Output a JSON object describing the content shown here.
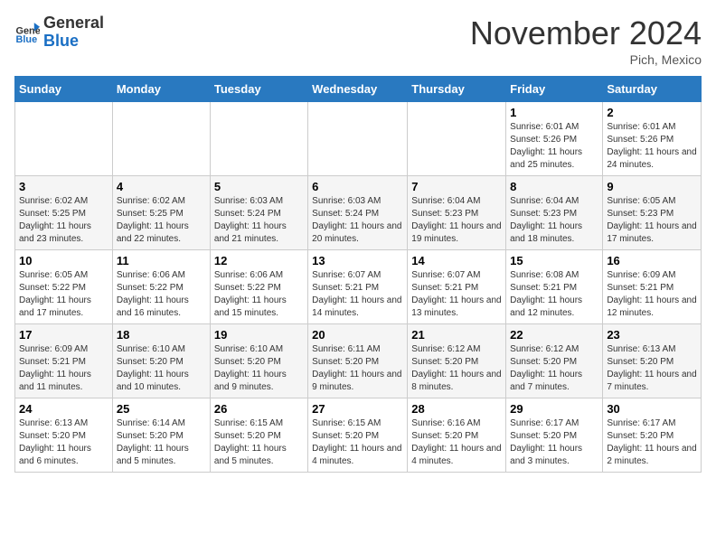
{
  "header": {
    "logo_line1": "General",
    "logo_line2": "Blue",
    "month_title": "November 2024",
    "location": "Pich, Mexico"
  },
  "weekdays": [
    "Sunday",
    "Monday",
    "Tuesday",
    "Wednesday",
    "Thursday",
    "Friday",
    "Saturday"
  ],
  "weeks": [
    [
      {
        "day": "",
        "info": ""
      },
      {
        "day": "",
        "info": ""
      },
      {
        "day": "",
        "info": ""
      },
      {
        "day": "",
        "info": ""
      },
      {
        "day": "",
        "info": ""
      },
      {
        "day": "1",
        "info": "Sunrise: 6:01 AM\nSunset: 5:26 PM\nDaylight: 11 hours and 25 minutes."
      },
      {
        "day": "2",
        "info": "Sunrise: 6:01 AM\nSunset: 5:26 PM\nDaylight: 11 hours and 24 minutes."
      }
    ],
    [
      {
        "day": "3",
        "info": "Sunrise: 6:02 AM\nSunset: 5:25 PM\nDaylight: 11 hours and 23 minutes."
      },
      {
        "day": "4",
        "info": "Sunrise: 6:02 AM\nSunset: 5:25 PM\nDaylight: 11 hours and 22 minutes."
      },
      {
        "day": "5",
        "info": "Sunrise: 6:03 AM\nSunset: 5:24 PM\nDaylight: 11 hours and 21 minutes."
      },
      {
        "day": "6",
        "info": "Sunrise: 6:03 AM\nSunset: 5:24 PM\nDaylight: 11 hours and 20 minutes."
      },
      {
        "day": "7",
        "info": "Sunrise: 6:04 AM\nSunset: 5:23 PM\nDaylight: 11 hours and 19 minutes."
      },
      {
        "day": "8",
        "info": "Sunrise: 6:04 AM\nSunset: 5:23 PM\nDaylight: 11 hours and 18 minutes."
      },
      {
        "day": "9",
        "info": "Sunrise: 6:05 AM\nSunset: 5:23 PM\nDaylight: 11 hours and 17 minutes."
      }
    ],
    [
      {
        "day": "10",
        "info": "Sunrise: 6:05 AM\nSunset: 5:22 PM\nDaylight: 11 hours and 17 minutes."
      },
      {
        "day": "11",
        "info": "Sunrise: 6:06 AM\nSunset: 5:22 PM\nDaylight: 11 hours and 16 minutes."
      },
      {
        "day": "12",
        "info": "Sunrise: 6:06 AM\nSunset: 5:22 PM\nDaylight: 11 hours and 15 minutes."
      },
      {
        "day": "13",
        "info": "Sunrise: 6:07 AM\nSunset: 5:21 PM\nDaylight: 11 hours and 14 minutes."
      },
      {
        "day": "14",
        "info": "Sunrise: 6:07 AM\nSunset: 5:21 PM\nDaylight: 11 hours and 13 minutes."
      },
      {
        "day": "15",
        "info": "Sunrise: 6:08 AM\nSunset: 5:21 PM\nDaylight: 11 hours and 12 minutes."
      },
      {
        "day": "16",
        "info": "Sunrise: 6:09 AM\nSunset: 5:21 PM\nDaylight: 11 hours and 12 minutes."
      }
    ],
    [
      {
        "day": "17",
        "info": "Sunrise: 6:09 AM\nSunset: 5:21 PM\nDaylight: 11 hours and 11 minutes."
      },
      {
        "day": "18",
        "info": "Sunrise: 6:10 AM\nSunset: 5:20 PM\nDaylight: 11 hours and 10 minutes."
      },
      {
        "day": "19",
        "info": "Sunrise: 6:10 AM\nSunset: 5:20 PM\nDaylight: 11 hours and 9 minutes."
      },
      {
        "day": "20",
        "info": "Sunrise: 6:11 AM\nSunset: 5:20 PM\nDaylight: 11 hours and 9 minutes."
      },
      {
        "day": "21",
        "info": "Sunrise: 6:12 AM\nSunset: 5:20 PM\nDaylight: 11 hours and 8 minutes."
      },
      {
        "day": "22",
        "info": "Sunrise: 6:12 AM\nSunset: 5:20 PM\nDaylight: 11 hours and 7 minutes."
      },
      {
        "day": "23",
        "info": "Sunrise: 6:13 AM\nSunset: 5:20 PM\nDaylight: 11 hours and 7 minutes."
      }
    ],
    [
      {
        "day": "24",
        "info": "Sunrise: 6:13 AM\nSunset: 5:20 PM\nDaylight: 11 hours and 6 minutes."
      },
      {
        "day": "25",
        "info": "Sunrise: 6:14 AM\nSunset: 5:20 PM\nDaylight: 11 hours and 5 minutes."
      },
      {
        "day": "26",
        "info": "Sunrise: 6:15 AM\nSunset: 5:20 PM\nDaylight: 11 hours and 5 minutes."
      },
      {
        "day": "27",
        "info": "Sunrise: 6:15 AM\nSunset: 5:20 PM\nDaylight: 11 hours and 4 minutes."
      },
      {
        "day": "28",
        "info": "Sunrise: 6:16 AM\nSunset: 5:20 PM\nDaylight: 11 hours and 4 minutes."
      },
      {
        "day": "29",
        "info": "Sunrise: 6:17 AM\nSunset: 5:20 PM\nDaylight: 11 hours and 3 minutes."
      },
      {
        "day": "30",
        "info": "Sunrise: 6:17 AM\nSunset: 5:20 PM\nDaylight: 11 hours and 2 minutes."
      }
    ]
  ]
}
